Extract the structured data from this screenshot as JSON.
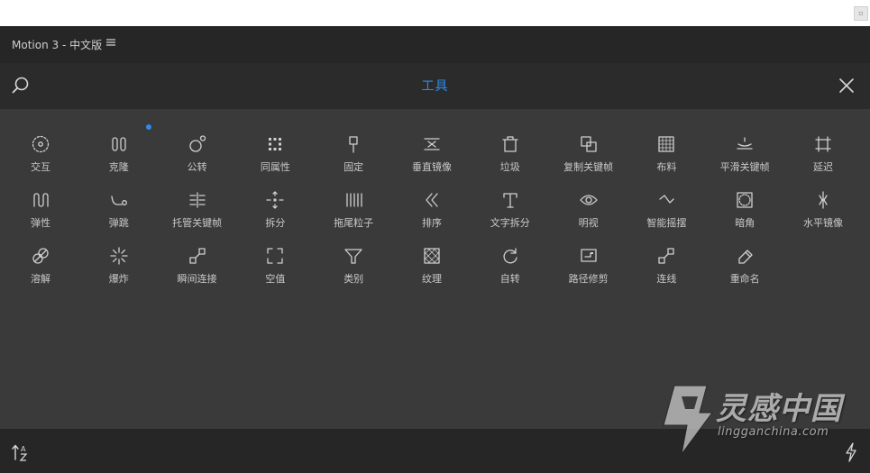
{
  "header": {
    "title": "Motion 3 - 中文版"
  },
  "searchbar": {
    "section_title": "工具"
  },
  "colors": {
    "accent": "#2d8ceb",
    "panel_bg": "#3a3a3a",
    "text": "#c9c9c9"
  },
  "tools": [
    {
      "label": "交互",
      "icon": "interaction-icon"
    },
    {
      "label": "克隆",
      "icon": "clone-icon"
    },
    {
      "label": "公转",
      "icon": "orbit-icon"
    },
    {
      "label": "同属性",
      "icon": "same-property-icon"
    },
    {
      "label": "固定",
      "icon": "pin-icon"
    },
    {
      "label": "垂直镜像",
      "icon": "vertical-mirror-icon"
    },
    {
      "label": "垃圾",
      "icon": "trash-icon"
    },
    {
      "label": "复制关键帧",
      "icon": "copy-keyframes-icon"
    },
    {
      "label": "布料",
      "icon": "cloth-icon"
    },
    {
      "label": "平滑关键帧",
      "icon": "smooth-keyframes-icon"
    },
    {
      "label": "延迟",
      "icon": "delay-icon"
    },
    {
      "label": "弹性",
      "icon": "elastic-icon"
    },
    {
      "label": "弹跳",
      "icon": "bounce-icon"
    },
    {
      "label": "托管关键帧",
      "icon": "hosted-keyframes-icon"
    },
    {
      "label": "拆分",
      "icon": "split-icon"
    },
    {
      "label": "拖尾粒子",
      "icon": "trail-particles-icon"
    },
    {
      "label": "排序",
      "icon": "sort-order-icon"
    },
    {
      "label": "文字拆分",
      "icon": "text-split-icon"
    },
    {
      "label": "明视",
      "icon": "eye-icon"
    },
    {
      "label": "智能摇摆",
      "icon": "smart-wiggle-icon"
    },
    {
      "label": "暗角",
      "icon": "vignette-icon"
    },
    {
      "label": "水平镜像",
      "icon": "horizontal-mirror-icon"
    },
    {
      "label": "溶解",
      "icon": "dissolve-icon"
    },
    {
      "label": "爆炸",
      "icon": "explode-icon"
    },
    {
      "label": "瞬间连接",
      "icon": "instant-connect-icon"
    },
    {
      "label": "空值",
      "icon": "null-icon"
    },
    {
      "label": "类别",
      "icon": "filter-icon"
    },
    {
      "label": "纹理",
      "icon": "texture-icon"
    },
    {
      "label": "自转",
      "icon": "rotate-icon"
    },
    {
      "label": "路径修剪",
      "icon": "path-trim-icon"
    },
    {
      "label": "连线",
      "icon": "connect-line-icon"
    },
    {
      "label": "重命名",
      "icon": "rename-icon"
    }
  ],
  "watermark": {
    "cn": "灵感中国",
    "en": "lingganchina.com"
  }
}
